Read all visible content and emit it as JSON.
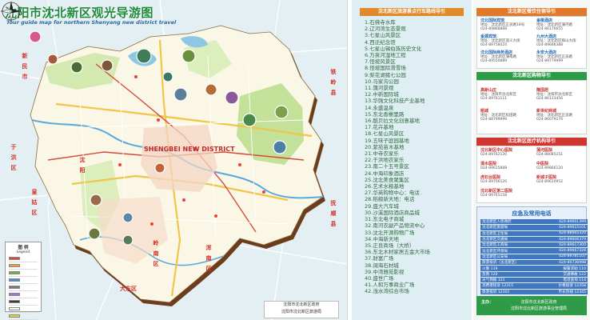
{
  "map": {
    "title": "沈阳市沈北新区观光导游图",
    "subtitle": "Tour guide map for northern Shenyang new district travel",
    "center_label": "SHENGBEI NEW DISTRICT",
    "districts": [
      {
        "id": "xinmin",
        "text": "新民市"
      },
      {
        "id": "yuhong",
        "text": "于洪区"
      },
      {
        "id": "huanggu",
        "text": "皇姑区"
      },
      {
        "id": "dadong",
        "text": "大东区"
      },
      {
        "id": "hunnan",
        "text": "浑南区"
      },
      {
        "id": "tieling",
        "text": "铁岭县"
      },
      {
        "id": "fushun",
        "text": "抚顺县"
      },
      {
        "id": "shen",
        "text": "沈阳"
      },
      {
        "id": "lingnan",
        "text": "岭南区"
      }
    ],
    "legend": {
      "title": "图 例",
      "subtitle": "Legend",
      "items": [
        {
          "color": "#d94a3a"
        },
        {
          "color": "#e8a23a"
        },
        {
          "color": "#6fb23f"
        },
        {
          "color": "#4a8fd6"
        },
        {
          "color": "#7a7a7a"
        },
        {
          "color": "#b36ad6"
        },
        {
          "color": "#3a3a3a"
        },
        {
          "color": "#ffffff"
        },
        {
          "color": "#e0d04a"
        }
      ]
    },
    "footer": [
      "沈阳市沈北新区政府",
      "沈阳市沈北新区旅游局"
    ]
  },
  "scenic_list": {
    "header": "沈北新区旅游景点行车路线导引",
    "items": [
      "1.石佛寺水库",
      "2.辽河湾生态景观",
      "3.七星山风景区",
      "4.西迁纪念馆",
      "5.七星山锡伯族历史文化",
      "6.万泉河湿地工程",
      "7.怪坡风景区",
      "8.怪坡国际滑雪场",
      "9.梨花湖猪七公园",
      "10.马家沟公园",
      "11.蒲河景观",
      "12.中新国际城",
      "13.华强文化科技产业基地",
      "14.永盛温泉",
      "15.东北香榭里路",
      "16.酷贝拉文化创意基地",
      "17.花卉基地",
      "18.七星山风景区",
      "19.五味子庭园基地",
      "20.紫苑苗木基地",
      "21.中寺农家乐",
      "22.于洪地农家乐",
      "23.南二十五号景区",
      "24.中海印象酒店",
      "25.沈北美食聚集区",
      "26.艺术水粮基地",
      "27.华英购物中心：电话",
      "28.稻粮新天地：电话",
      "29.盛大汽车城",
      "30.沙溪国际酒店商品城",
      "31.东北电子商城",
      "32.南河农副产品物流中心",
      "33.沈北开源购物广场",
      "34.中海新天地",
      "35.正良商场（大桥）",
      "36.东北木材家居五金大市场",
      "37.财富广场",
      "38.阔海石材城",
      "39.中湾雅苑影视",
      "40.盛世广场",
      "41.人和万事商业广场",
      "42.浅水湾综合市场"
    ]
  },
  "directory": {
    "dining": {
      "header": "沈北新区餐饮住宿导引",
      "entries": [
        {
          "name": "沈北国际宾馆",
          "detail": "地址：沈北新区正良路18号",
          "phone": "024-89868888"
        },
        {
          "name": "金桃酒店",
          "detail": "地址：沈北新区蒲河路",
          "phone": "024-86176655"
        },
        {
          "name": "金源宾馆",
          "detail": "地址：沈北新区道义大街",
          "phone": "024-89758024"
        },
        {
          "name": "九州大酒店",
          "detail": "地址：沈北新区辉山大街",
          "phone": "024-89666388"
        },
        {
          "name": "沈北国际商务酒店",
          "detail": "地址：沈北新区蒲南路",
          "phone": "024-89550889"
        },
        {
          "name": "永安大酒店",
          "detail": "地址：沈北新区正良路",
          "phone": "024-89779999"
        }
      ]
    },
    "shopping": {
      "header": "沈北新区购物导引",
      "entries": [
        {
          "name": "高新山庄",
          "detail": "地址：沈阳市沈北新区",
          "phone": "024-89761111"
        },
        {
          "name": "隆国居",
          "detail": "地址：沈阳市沈北新区",
          "phone": "024-86133456"
        },
        {
          "name": "稻城",
          "detail": "地址：沈北新区稻田路",
          "phone": "024-88799999"
        },
        {
          "name": "新世纪商城",
          "detail": "地址：沈北新区正良路",
          "phone": "024-86079176"
        }
      ]
    },
    "medical": {
      "header": "沈北新区医疗机构导引",
      "entries": [
        {
          "name": "沈北新区中心医院",
          "detail": "地址：沈北新区蒲河路",
          "phone": "024-89762120"
        },
        {
          "name": "蒲河医院",
          "detail": "地址：沈北新区",
          "phone": "024-88085251"
        },
        {
          "name": "清水医院",
          "detail": "地址：沈北新区",
          "phone": "024-89615888"
        },
        {
          "name": "中医院",
          "detail": "地址：沈北新区",
          "phone": "024-89866120"
        },
        {
          "name": "虎石台医院",
          "detail": "地址：沈北新区",
          "phone": "024-89706120"
        },
        {
          "name": "新城子医院",
          "detail": "地址：沈北新区",
          "phone": "024-89610952"
        },
        {
          "name": "沈北新区第二医院",
          "detail": "地址：沈北新区",
          "phone": "024-89765158"
        }
      ]
    },
    "emergency": {
      "title": "应急及常用电话",
      "rows": [
        {
          "name": "沈北新区人民政府",
          "phone": "024-89601399"
        },
        {
          "name": "沈北新区旅游局",
          "phone": "024-89615101"
        },
        {
          "name": "沈北新区卫生局",
          "phone": "024-88665320"
        },
        {
          "name": "沈北新区交通局",
          "phone": "024-89606379"
        },
        {
          "name": "沈北新区工商局",
          "phone": "024-89617300"
        },
        {
          "name": "沈北新区环保局",
          "phone": "024-89667328"
        },
        {
          "name": "沈北新区公安局",
          "phone": "024-89781107"
        },
        {
          "name": "旅游投诉（沈北新区）",
          "phone": "024-89736998"
        },
        {
          "name": "火警 119",
          "phone": "报警求助 110"
        },
        {
          "name": "急救 120",
          "phone": "交通事故 122"
        },
        {
          "name": "天气预报 121",
          "phone": "电话查询 114"
        },
        {
          "name": "消费者投诉 12315",
          "phone": "价格投诉 12358"
        },
        {
          "name": "旅游投诉 12301",
          "phone": "市长热线 12345"
        }
      ]
    },
    "sponsor": {
      "label": "主办：",
      "lines": [
        "沈阳市沈北新区政府",
        "沈阳市沈北新区旅游事业管理局"
      ]
    }
  }
}
